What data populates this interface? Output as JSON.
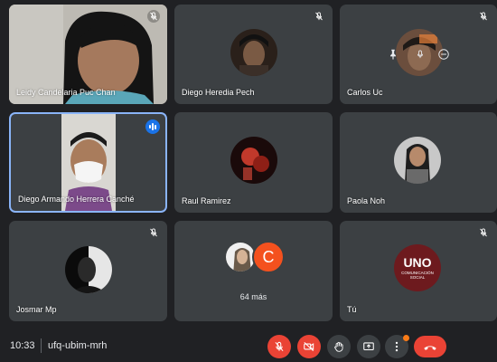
{
  "participants": {
    "p1": {
      "name": "Leidy Candelaria Puc Chan"
    },
    "p2": {
      "name": "Diego Heredia Pech"
    },
    "p3": {
      "name": "Carlos Uc"
    },
    "p4": {
      "name": "Diego Armando Herrera Canché"
    },
    "p5": {
      "name": "Raul Ramirez"
    },
    "p6": {
      "name": "Paola Noh"
    },
    "p7": {
      "name": "Josmar Mp"
    },
    "others": {
      "initial": "C",
      "count_label": "64 más"
    },
    "self": {
      "name": "Tú",
      "logo_text": "UNO",
      "logo_subtitle": "COMUNICACIÓN SOCIAL"
    }
  },
  "bottom_bar": {
    "time": "10:33",
    "meeting_code": "ufq-ubim-mrh"
  },
  "colors": {
    "background": "#202124",
    "tile": "#3c4043",
    "accent_blue": "#1a73e8",
    "active_border": "#8ab4f8",
    "danger_red": "#ea4335",
    "notification_orange": "#fa7b17"
  },
  "icons": [
    "mic-off-icon",
    "speaking-indicator-icon",
    "pin-icon",
    "mute-icon",
    "remove-icon",
    "camera-off-icon",
    "raise-hand-icon",
    "present-icon",
    "more-options-icon",
    "hangup-icon"
  ]
}
